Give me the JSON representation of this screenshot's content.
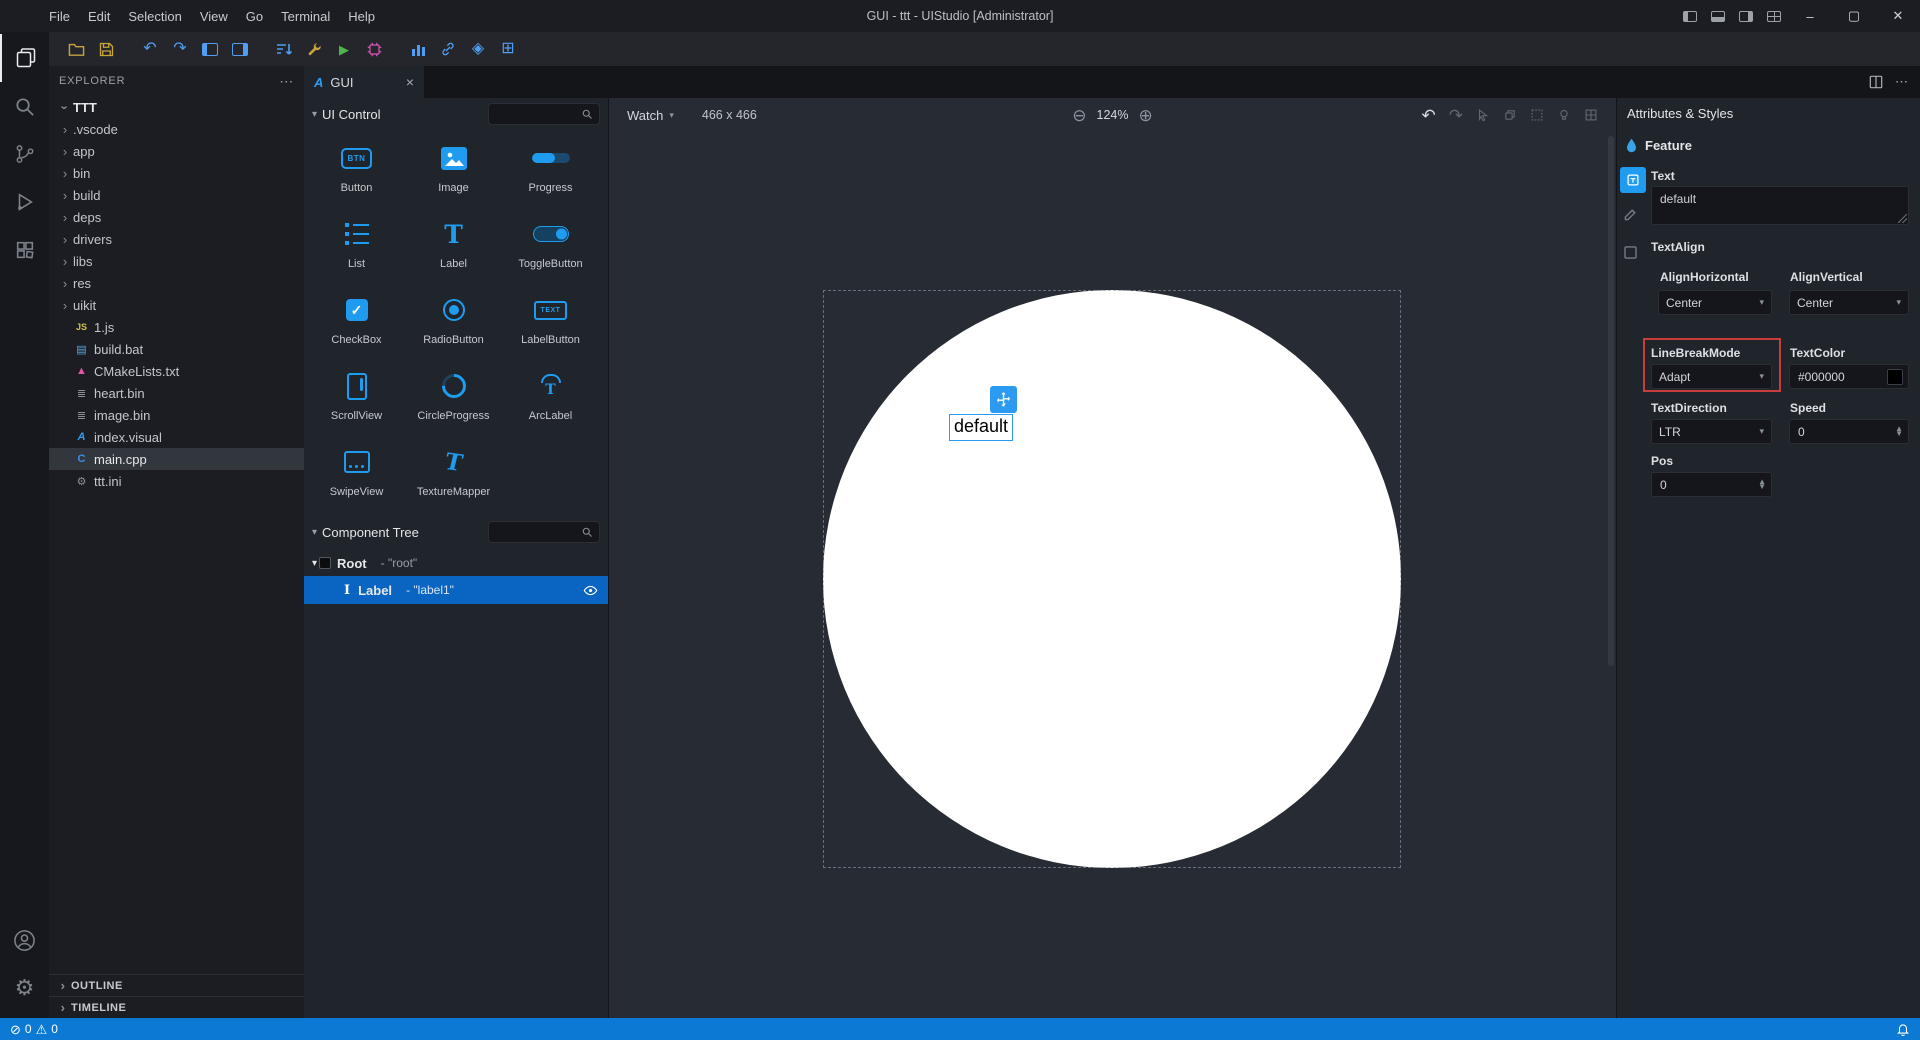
{
  "titlebar": {
    "menus": [
      "File",
      "Edit",
      "Selection",
      "View",
      "Go",
      "Terminal",
      "Help"
    ],
    "title": "GUI - ttt - UIStudio [Administrator]"
  },
  "explorer": {
    "header": "EXPLORER",
    "root": "TTT",
    "folders": [
      ".vscode",
      "app",
      "bin",
      "build",
      "deps",
      "drivers",
      "libs",
      "res",
      "uikit"
    ],
    "files": [
      "1.js",
      "build.bat",
      "CMakeLists.txt",
      "heart.bin",
      "image.bin",
      "index.visual",
      "main.cpp",
      "ttt.ini"
    ],
    "outline": "OUTLINE",
    "timeline": "TIMELINE"
  },
  "tab": {
    "label": "GUI"
  },
  "ui_control": {
    "title": "UI Control",
    "items": [
      "Button",
      "Image",
      "Progress",
      "List",
      "Label",
      "ToggleButton",
      "CheckBox",
      "RadioButton",
      "LabelButton",
      "ScrollView",
      "CircleProgress",
      "ArcLabel",
      "SwipeView",
      "TextureMapper"
    ],
    "icon_text": {
      "btn": "BTN",
      "text": "TEXT",
      "t": "T"
    }
  },
  "component_tree": {
    "title": "Component Tree",
    "root": {
      "label": "Root",
      "value": "- \"root\""
    },
    "node": {
      "label": "Label",
      "value": "- \"label1\""
    }
  },
  "canvas": {
    "device": "Watch",
    "size": "466 x 466",
    "zoom": "124%",
    "label_text": "default"
  },
  "attributes": {
    "title": "Attributes & Styles",
    "section": "Feature",
    "text": {
      "label": "Text",
      "value": "default"
    },
    "textalign": {
      "label": "TextAlign",
      "h_label": "AlignHorizontal",
      "h_value": "Center",
      "v_label": "AlignVertical",
      "v_value": "Center"
    },
    "linebreak": {
      "label": "LineBreakMode",
      "value": "Adapt"
    },
    "textcolor": {
      "label": "TextColor",
      "value": "#000000"
    },
    "textdirection": {
      "label": "TextDirection",
      "value": "LTR"
    },
    "speed": {
      "label": "Speed",
      "value": "0"
    },
    "pos": {
      "label": "Pos",
      "value": "0"
    }
  },
  "statusbar": {
    "errors": "0",
    "warnings": "0"
  },
  "icons": {
    "explorer": "pages",
    "search": "magnifier",
    "source_control": "git-branch",
    "run_debug": "play",
    "extensions": "squares-grid",
    "account": "person-circle",
    "settings": "gear",
    "bell": "bell",
    "eye": "eye",
    "move_handle": "move-cross",
    "close": "x",
    "zoom_out": "circle-minus",
    "zoom_in": "circle-plus",
    "undo": "curved-arrow-left",
    "redo": "curved-arrow-right"
  },
  "colors": {
    "accent": "#1f9cf0",
    "selection": "#0a65c2",
    "statusbar_bg": "#0c79d4",
    "highlight_red": "#c83c3c",
    "text_color_swatch": "#000000",
    "canvas_face": "#ffffff"
  }
}
